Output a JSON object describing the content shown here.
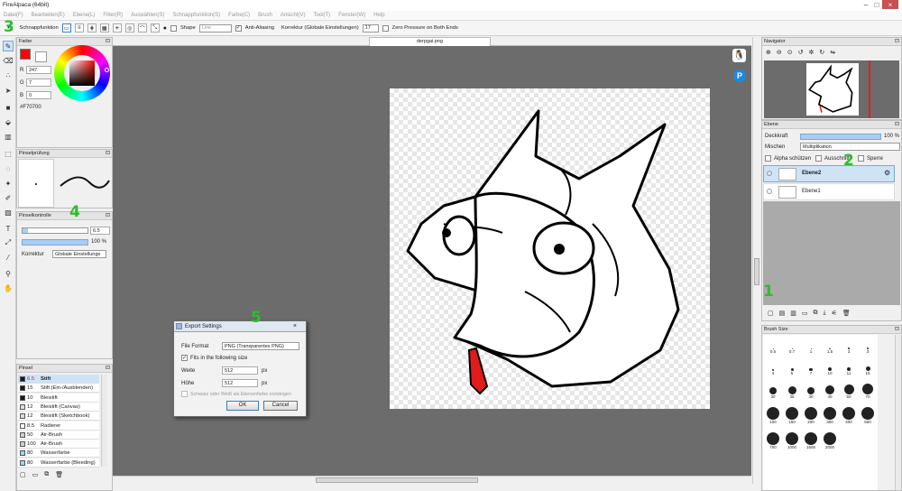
{
  "app_title": "FireAlpaca (64bit)",
  "menu": [
    "Datei(F)",
    "Bearbeiten(E)",
    "Ebene(L)",
    "Filter(R)",
    "Auswählen(S)",
    "Schnappfunktion(S)",
    "Farbe(C)",
    "Brush",
    "Ansicht(V)",
    "Tool(T)",
    "Fenster(W)",
    "Help"
  ],
  "toolbar": {
    "snap_label": "Schnappfunktion",
    "shape_label": "Shape",
    "shape_value": "Line",
    "antialias_label": "Anti-Aliasing",
    "correction_label": "Korrektur (Globale Einstellungen)",
    "correction_value": "17",
    "zero_pressure_label": "Zero Pressure on Both Ends"
  },
  "farbe": {
    "title": "Farbe",
    "r_label": "R",
    "r": "247",
    "g_label": "G",
    "g": "7",
    "b_label": "B",
    "b": "0",
    "hex": "#F70700",
    "primary": "#f70700"
  },
  "pinselpruefung": {
    "title": "Pinselprüfung"
  },
  "pinselkontrolle": {
    "title": "Pinselkontrolle",
    "size_value": "6.5",
    "opacity_value": "100 %",
    "korrektur_label": "Korrektur",
    "korrektur_value": "Globale Einstellunge"
  },
  "pinsel": {
    "title": "Pinsel",
    "items": [
      {
        "size": "6.5",
        "name": "Stift",
        "color": "#1a1a1a",
        "selected": true
      },
      {
        "size": "15",
        "name": "Stift (Ein-/Ausblenden)",
        "color": "#1a1a1a"
      },
      {
        "size": "10",
        "name": "Bleistift",
        "color": "#1a1a1a"
      },
      {
        "size": "12",
        "name": "Bleistift (Canvas)",
        "color": "#dddddd"
      },
      {
        "size": "12",
        "name": "Bleistift (Sketchbook)",
        "color": "#dddddd"
      },
      {
        "size": "8.5",
        "name": "Radierer",
        "color": "#ffffff"
      },
      {
        "size": "50",
        "name": "Air-Brush",
        "color": "#cfcfcf"
      },
      {
        "size": "100",
        "name": "Air-Brush",
        "color": "#cfcfcf"
      },
      {
        "size": "80",
        "name": "Wasserfarbe",
        "color": "#9fd6f5"
      },
      {
        "size": "80",
        "name": "Wasserfarbe (Bleeding)",
        "color": "#9fd6f5"
      }
    ]
  },
  "document": {
    "tab": "derpgai.png"
  },
  "navigator": {
    "title": "Navigator"
  },
  "ebene": {
    "title": "Ebene",
    "opacity_label": "Deckkraft",
    "opacity_value": "100 %",
    "blend_label": "Mischen",
    "blend_value": "Multiplikation",
    "protect_alpha": "Alpha schützen",
    "clipping": "Ausschnitt",
    "lock": "Sperre",
    "layers": [
      {
        "name": "Ebene2",
        "selected": true
      },
      {
        "name": "Ebene1",
        "selected": false
      }
    ]
  },
  "brush_size": {
    "title": "Brush Size",
    "sizes": [
      "0.5",
      "0.7",
      "1",
      "1.5",
      "3",
      "3",
      "4",
      "5",
      "7",
      "10",
      "11",
      "15",
      "30",
      "35",
      "30",
      "40",
      "50",
      "70",
      "100",
      "150",
      "200",
      "300",
      "400",
      "500",
      "700",
      "1000",
      "1500",
      "2000"
    ]
  },
  "export_dialog": {
    "title": "Export Settings",
    "file_format_label": "File Format",
    "file_format_value": "PNG (Transparentes PNG)",
    "fit_label": "Fits in the following size",
    "width_label": "Weite",
    "width_value": "512",
    "width_unit": "px",
    "height_label": "Höhe",
    "height_value": "512",
    "height_unit": "px",
    "bw_label": "Schwarz oder Weiß als Ebenenfarbe erzwingen",
    "ok": "OK",
    "cancel": "Cancel"
  },
  "annotations": {
    "n1": "1",
    "n2": "2",
    "n3": "3",
    "n4": "4",
    "n5": "5"
  },
  "colors": {
    "accent_green": "#2bbf2b",
    "selection_blue": "#cfe3f7",
    "canvas_bg": "#6c6c6c"
  }
}
